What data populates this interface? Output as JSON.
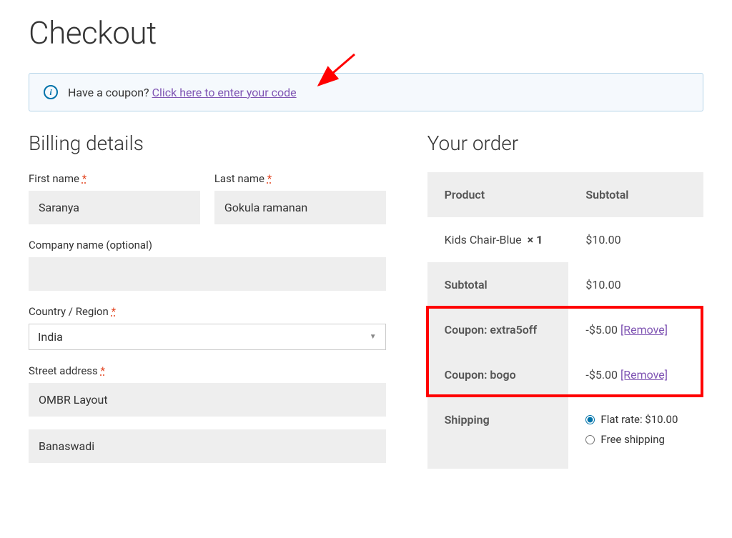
{
  "page_title": "Checkout",
  "coupon_notice": {
    "prompt": "Have a coupon? ",
    "link": "Click here to enter your code"
  },
  "billing": {
    "heading": "Billing details",
    "first_name_label": "First name",
    "first_name_value": "Saranya",
    "last_name_label": "Last name",
    "last_name_value": "Gokula ramanan",
    "company_label": "Company name (optional)",
    "company_value": "",
    "country_label": "Country / Region",
    "country_value": "India",
    "street_label": "Street address",
    "street_value1": "OMBR Layout",
    "street_value2": "Banaswadi"
  },
  "order": {
    "heading": "Your order",
    "header_product": "Product",
    "header_subtotal": "Subtotal",
    "items": [
      {
        "name": "Kids Chair-Blue",
        "qty": "× 1",
        "subtotal": "$10.00"
      }
    ],
    "subtotal_label": "Subtotal",
    "subtotal_value": "$10.00",
    "coupons": [
      {
        "label": "Coupon: extra5off",
        "amount": "-$5.00",
        "remove": "[Remove]"
      },
      {
        "label": "Coupon: bogo",
        "amount": "-$5.00",
        "remove": "[Remove]"
      }
    ],
    "shipping_label": "Shipping",
    "shipping_options": [
      {
        "label": "Flat rate: $10.00",
        "checked": true
      },
      {
        "label": "Free shipping",
        "checked": false
      }
    ]
  },
  "required_marker": "*"
}
